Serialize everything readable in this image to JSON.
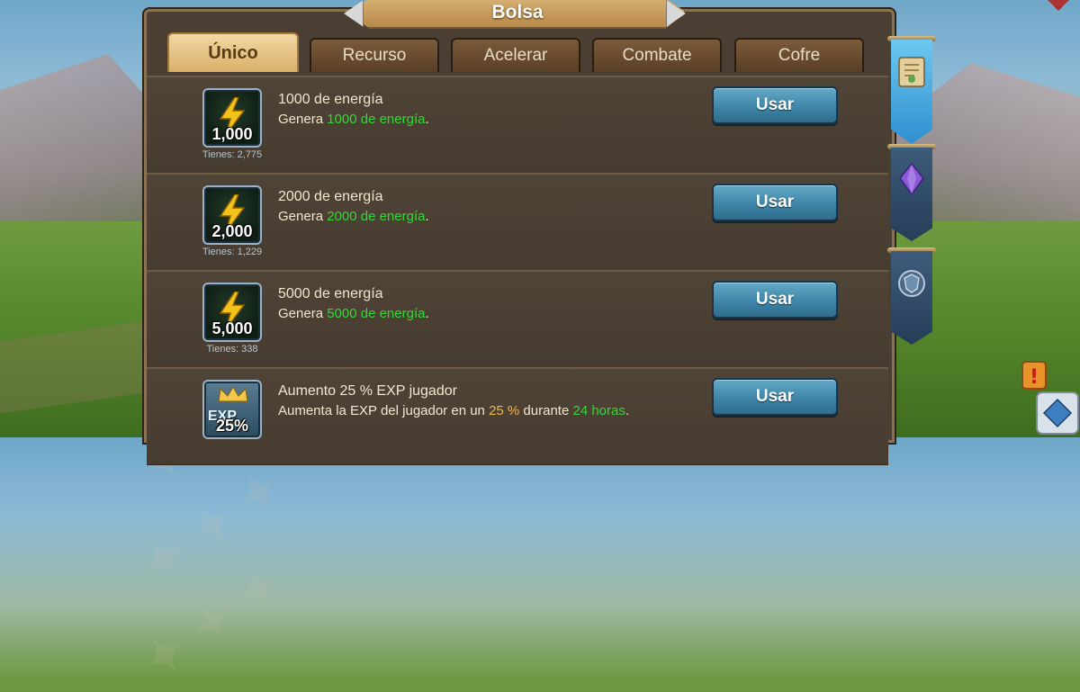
{
  "title": "Bolsa",
  "tabs": [
    {
      "label": "Único",
      "active": true
    },
    {
      "label": "Recurso",
      "active": false
    },
    {
      "label": "Acelerar",
      "active": false
    },
    {
      "label": "Combate",
      "active": false
    },
    {
      "label": "Cofre",
      "active": false
    }
  ],
  "items": [
    {
      "icon": "energy-bolt-icon",
      "qty": "1,000",
      "owned": "Tienes: 2,775",
      "name": "1000 de energía",
      "desc_prefix": "Genera ",
      "desc_highlight": "1000 de energía",
      "desc_suffix": ".",
      "button": "Usar"
    },
    {
      "icon": "energy-bolt-icon",
      "qty": "2,000",
      "owned": "Tienes: 1,229",
      "name": "2000 de energía",
      "desc_prefix": "Genera ",
      "desc_highlight": "2000 de energía",
      "desc_suffix": ".",
      "button": "Usar"
    },
    {
      "icon": "energy-bolt-icon",
      "qty": "5,000",
      "owned": "Tienes: 338",
      "name": "5000 de energía",
      "desc_prefix": "Genera ",
      "desc_highlight": "5000 de energía",
      "desc_suffix": ".",
      "button": "Usar"
    },
    {
      "icon": "exp-boost-icon",
      "qty": "25%",
      "icon_text": "EXP",
      "name": "Aumento 25 % EXP jugador",
      "desc_prefix": "Aumenta la EXP del jugador en un ",
      "desc_highlight_orange": "25 %",
      "desc_middle": " durante ",
      "desc_highlight": "24 horas",
      "desc_suffix": ".",
      "button": "Usar"
    }
  ],
  "side_tabs": [
    {
      "icon": "scroll-map-icon",
      "active": true
    },
    {
      "icon": "purple-gem-icon",
      "active": false
    },
    {
      "icon": "shield-emblem-icon",
      "active": false
    }
  ],
  "colors": {
    "accent_green": "#35d63a",
    "accent_orange": "#f0b74a",
    "button_blue": "#3e85a8",
    "panel_brown": "#4a3f32"
  }
}
